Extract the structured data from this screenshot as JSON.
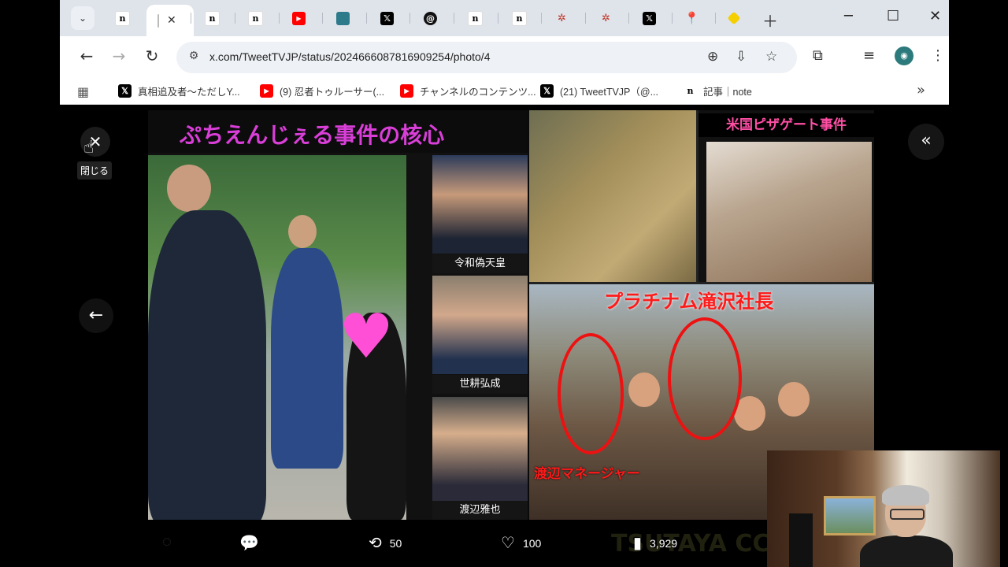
{
  "window": {
    "tabs": [
      {
        "icon": "note-icon",
        "glyph": "n"
      },
      {
        "icon": "blank-icon",
        "glyph": "",
        "active": true
      },
      {
        "icon": "note-icon",
        "glyph": "n"
      },
      {
        "icon": "note-icon",
        "glyph": "n"
      },
      {
        "icon": "youtube-icon",
        "glyph": "▶"
      },
      {
        "icon": "teal-icon",
        "glyph": ""
      },
      {
        "icon": "x-icon",
        "glyph": "𝕏"
      },
      {
        "icon": "threads-icon",
        "glyph": "@"
      },
      {
        "icon": "note-icon",
        "glyph": "n"
      },
      {
        "icon": "note-icon",
        "glyph": "n"
      },
      {
        "icon": "dots-icon",
        "glyph": "✲"
      },
      {
        "icon": "dots-icon",
        "glyph": "✲"
      },
      {
        "icon": "x-icon",
        "glyph": "𝕏"
      },
      {
        "icon": "maps-icon",
        "glyph": "⬤"
      },
      {
        "icon": "diamond-icon",
        "glyph": ""
      }
    ],
    "controls": {
      "minimize": "─",
      "maximize": "☐",
      "close": "✕"
    }
  },
  "toolbar": {
    "url": "x.com/TweetTVJP/status/2024666087816909254/photo/4"
  },
  "bookmarks": [
    {
      "icon": "x-icon",
      "glyph": "𝕏",
      "label": "真相追及者～ただしY..."
    },
    {
      "icon": "youtube-icon",
      "glyph": "▶",
      "label": "(9) 忍者トゥルーサー(..."
    },
    {
      "icon": "youtube-icon",
      "glyph": "▶",
      "label": "チャンネルのコンテンツ..."
    },
    {
      "icon": "x-icon",
      "glyph": "𝕏",
      "label": "(21) TweetTVJP（@..."
    },
    {
      "icon": "note-icon",
      "glyph": "n",
      "label": "記事｜note"
    }
  ],
  "viewer": {
    "close_tooltip": "閉じる",
    "image": {
      "title_left": "ぷちえんじぇる事件の核心",
      "face_labels": [
        "令和偽天皇",
        "世耕弘成",
        "渡辺雅也"
      ],
      "title_top_right": "米国ピザゲート事件",
      "title_bottom_right": "プラチナム滝沢社長",
      "label_bottom_right": "渡辺マネージャー",
      "watermark": "TSUTAYA CCC"
    },
    "actions": {
      "replies": "",
      "retweets": "50",
      "likes": "100",
      "views": "3,929"
    }
  }
}
